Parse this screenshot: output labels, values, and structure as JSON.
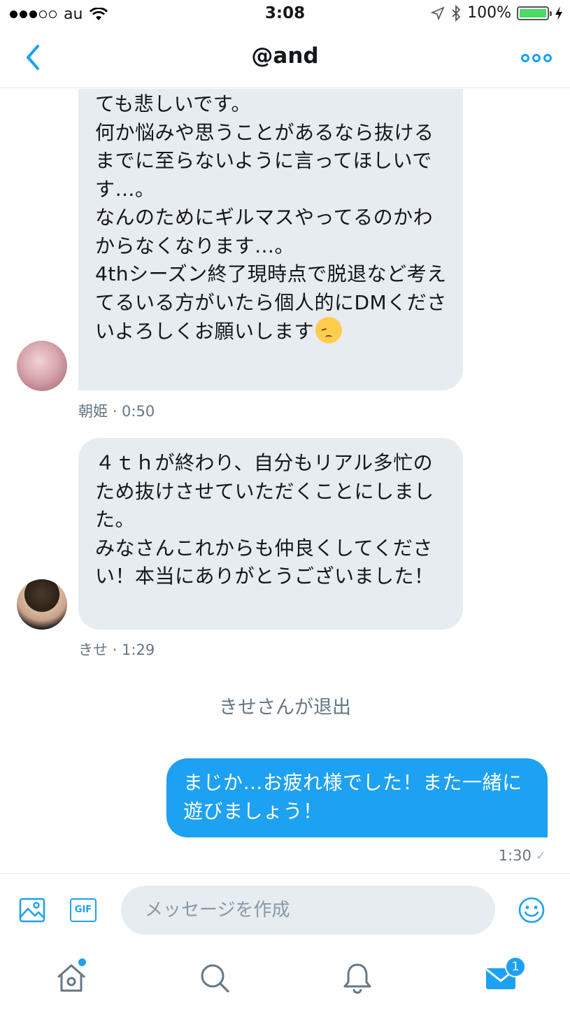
{
  "status_bar": {
    "carrier": "au",
    "time": "3:08",
    "battery": "100%"
  },
  "header": {
    "title": "@and"
  },
  "messages": [
    {
      "direction": "incoming",
      "text": "ても悲しいです。\n何か悩みや思うことがあるなら抜けるまでに至らないように言ってほしいです…。\nなんのためにギルマスやってるのかわからなくなります…。\n4thシーズン終了現時点で脱退など考えてるいる方がいたら個人的にDMくださいよろしくお願いします",
      "emoji": "pensive-face",
      "sender": "朝姫",
      "time": "0:50"
    },
    {
      "direction": "incoming",
      "text": "４ｔｈが終わり、自分もリアル多忙のため抜けさせていただくことにしました。\nみなさんこれからも仲良くしてください！本当にありがとうございました！",
      "sender": "きせ",
      "time": "1:29"
    },
    {
      "direction": "system",
      "text": "きせさんが退出"
    },
    {
      "direction": "outgoing",
      "text": "まじか…お疲れ様でした！また一緒に遊びましょう！",
      "time": "1:30"
    }
  ],
  "composer": {
    "gif_label": "GIF",
    "placeholder": "メッセージを作成"
  },
  "tab_bar": {
    "messages_badge": "1"
  },
  "colors": {
    "accent": "#1da1f2",
    "incoming_bubble": "#e6ecf0",
    "meta_text": "#657786"
  }
}
